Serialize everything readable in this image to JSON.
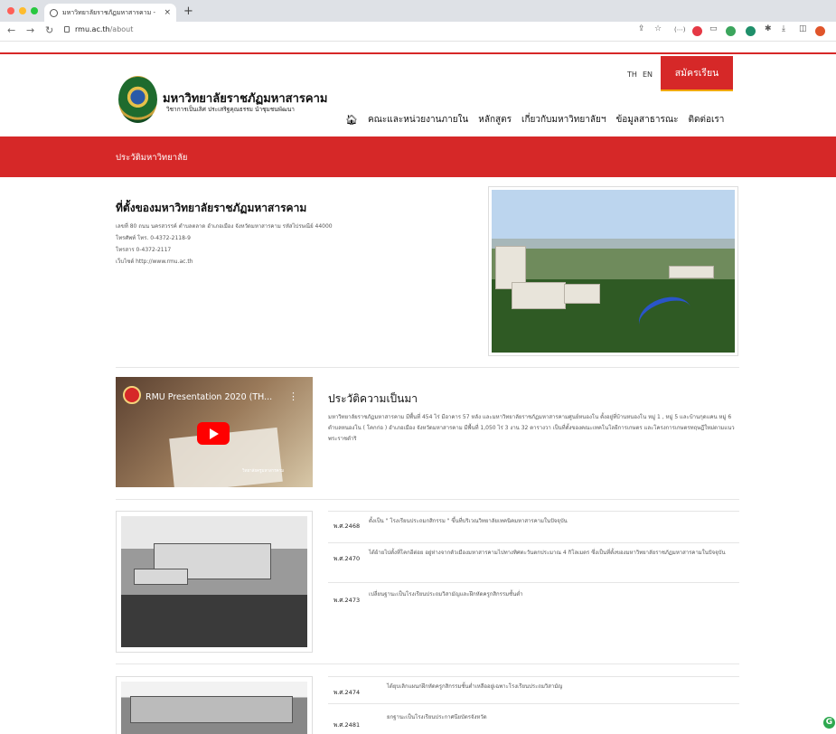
{
  "browser": {
    "tab_title": "มหาวิทยาลัยราชภัฏมหาสารคาม - ",
    "tab_close": "×",
    "new_tab": "+",
    "url_host": "rmu.ac.th",
    "url_path": "/about",
    "colors": {
      "close": "#ff5f57",
      "min": "#febc2e",
      "max": "#28c840"
    }
  },
  "header": {
    "site_name": "มหาวิทยาลัยราชภัฏมหาสารคาม",
    "site_tagline": "วิชาการเป็นเลิศ ประเสริฐคุณธรรม นำชุมชนพัฒนา",
    "lang_th": "TH",
    "lang_en": "EN",
    "apply_label": "สมัครเรียน",
    "nav": [
      "คณะและหน่วยงานภายใน",
      "หลักสูตร",
      "เกี่ยวกับมหาวิทยาลัยฯ",
      "ข้อมูลสาธารณะ",
      "ติดต่อเรา"
    ]
  },
  "banner": {
    "title": "ประวัติมหาวิทยาลัย"
  },
  "location": {
    "heading": "ที่ตั้งของมหาวิทยาลัยราชภัฏมหาสารคาม",
    "address": "เลขที่ 80 ถนน นครสวรรค์ ตำบลตลาด อำเภอเมือง จังหวัดมหาสารคาม รหัสไปรษณีย์ 44000",
    "phone": "โทรศัพท์ โทร. 0-4372-2118-9",
    "fax": "โทรสาร 0-4372-2117",
    "website": "เว็บไซต์ http://www.rmu.ac.th"
  },
  "video": {
    "title": "RMU Presentation 2020 (TH...",
    "caption": "วิทยาลัยครูมหาสารคาม"
  },
  "history": {
    "heading": "ประวัติความเป็นมา",
    "body": "มหาวิทยาลัยราชภัฏมหาสารคาม มีพื้นที่ 454 ไร่ มีอาคาร 57 หลัง และมหาวิทยาลัยราชภัฏมหาสารคามศูนย์หนองโน ตั้งอยู่ที่บ้านหนองโน หมู่ 1 , หมู่ 5 และบ้านกุดแคน หมู่ 6 ตำบลหนองโน ( โคกก่อ ) อำเภอเมือง จังหวัดมหาสารคาม มีพื้นที่ 1,050 ไร่ 3 งาน 32 ตารางวา เป็นที่ตั้งของคณะเทคโนโลยีการเกษตร และโครงการเกษตรทฤษฎีใหม่ตามแนวพระราชดำริ"
  },
  "timeline1": [
    {
      "year": "พ.ศ.2468",
      "text": "ตั้งเป็น \" โรงเรียนประถมกสิกรรม \" ขึ้นที่บริเวณวิทยาลัยเทคนิคมหาสารคามในปัจจุบัน"
    },
    {
      "year": "พ.ศ.2470",
      "text": "ได้ย้ายไปตั้งที่โคกอีต่อย อยู่ห่างจากตัวเมืองมหาสารคามไปทางทิศตะวันตกประมาณ 4 กิโลเมตร ซึ่งเป็นที่ตั้งของมหาวิทยาลัยราชภัฏมหาสารคามในปัจจุบัน"
    },
    {
      "year": "พ.ศ.2473",
      "text": "เปลี่ยนฐานะเป็นโรงเรียนประถมวิสามัญและฝึกหัดครูกสิกรรมชั้นต่ำ"
    }
  ],
  "timeline2": [
    {
      "year": "พ.ศ.2474",
      "text": "ได้ยุบเลิกแผนกฝึกหัดครูกสิกรรมชั้นต่ำเหลืออยู่เฉพาะโรงเรียนประถมวิสามัญ"
    },
    {
      "year": "พ.ศ.2481",
      "text": "ยกฐานะเป็นโรงเรียนประกาศนียบัตรจังหวัด"
    }
  ]
}
